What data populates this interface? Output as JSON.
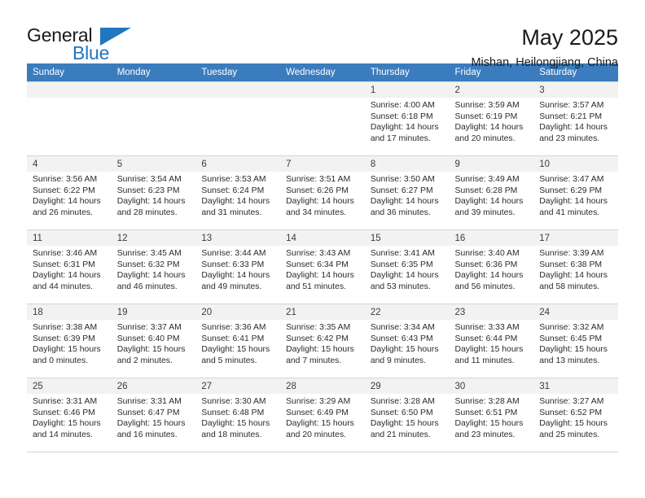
{
  "brand": {
    "name_top": "General",
    "name_bottom": "Blue",
    "accent_color": "#2077c0",
    "flag_icon": "brand-flag-icon"
  },
  "header": {
    "title": "May 2025",
    "subtitle": "Mishan, Heilongjiang, China"
  },
  "calendar": {
    "header_bg": "#3a7cbe",
    "daynum_bg": "#f2f2f2",
    "grid_line_color": "#d5d5d5",
    "weekday_headers": [
      "Sunday",
      "Monday",
      "Tuesday",
      "Wednesday",
      "Thursday",
      "Friday",
      "Saturday"
    ],
    "weeks": [
      [
        {
          "day": ""
        },
        {
          "day": ""
        },
        {
          "day": ""
        },
        {
          "day": ""
        },
        {
          "day": "1",
          "sunrise": "Sunrise: 4:00 AM",
          "sunset": "Sunset: 6:18 PM",
          "daylight_1": "Daylight: 14 hours",
          "daylight_2": "and 17 minutes."
        },
        {
          "day": "2",
          "sunrise": "Sunrise: 3:59 AM",
          "sunset": "Sunset: 6:19 PM",
          "daylight_1": "Daylight: 14 hours",
          "daylight_2": "and 20 minutes."
        },
        {
          "day": "3",
          "sunrise": "Sunrise: 3:57 AM",
          "sunset": "Sunset: 6:21 PM",
          "daylight_1": "Daylight: 14 hours",
          "daylight_2": "and 23 minutes."
        }
      ],
      [
        {
          "day": "4",
          "sunrise": "Sunrise: 3:56 AM",
          "sunset": "Sunset: 6:22 PM",
          "daylight_1": "Daylight: 14 hours",
          "daylight_2": "and 26 minutes."
        },
        {
          "day": "5",
          "sunrise": "Sunrise: 3:54 AM",
          "sunset": "Sunset: 6:23 PM",
          "daylight_1": "Daylight: 14 hours",
          "daylight_2": "and 28 minutes."
        },
        {
          "day": "6",
          "sunrise": "Sunrise: 3:53 AM",
          "sunset": "Sunset: 6:24 PM",
          "daylight_1": "Daylight: 14 hours",
          "daylight_2": "and 31 minutes."
        },
        {
          "day": "7",
          "sunrise": "Sunrise: 3:51 AM",
          "sunset": "Sunset: 6:26 PM",
          "daylight_1": "Daylight: 14 hours",
          "daylight_2": "and 34 minutes."
        },
        {
          "day": "8",
          "sunrise": "Sunrise: 3:50 AM",
          "sunset": "Sunset: 6:27 PM",
          "daylight_1": "Daylight: 14 hours",
          "daylight_2": "and 36 minutes."
        },
        {
          "day": "9",
          "sunrise": "Sunrise: 3:49 AM",
          "sunset": "Sunset: 6:28 PM",
          "daylight_1": "Daylight: 14 hours",
          "daylight_2": "and 39 minutes."
        },
        {
          "day": "10",
          "sunrise": "Sunrise: 3:47 AM",
          "sunset": "Sunset: 6:29 PM",
          "daylight_1": "Daylight: 14 hours",
          "daylight_2": "and 41 minutes."
        }
      ],
      [
        {
          "day": "11",
          "sunrise": "Sunrise: 3:46 AM",
          "sunset": "Sunset: 6:31 PM",
          "daylight_1": "Daylight: 14 hours",
          "daylight_2": "and 44 minutes."
        },
        {
          "day": "12",
          "sunrise": "Sunrise: 3:45 AM",
          "sunset": "Sunset: 6:32 PM",
          "daylight_1": "Daylight: 14 hours",
          "daylight_2": "and 46 minutes."
        },
        {
          "day": "13",
          "sunrise": "Sunrise: 3:44 AM",
          "sunset": "Sunset: 6:33 PM",
          "daylight_1": "Daylight: 14 hours",
          "daylight_2": "and 49 minutes."
        },
        {
          "day": "14",
          "sunrise": "Sunrise: 3:43 AM",
          "sunset": "Sunset: 6:34 PM",
          "daylight_1": "Daylight: 14 hours",
          "daylight_2": "and 51 minutes."
        },
        {
          "day": "15",
          "sunrise": "Sunrise: 3:41 AM",
          "sunset": "Sunset: 6:35 PM",
          "daylight_1": "Daylight: 14 hours",
          "daylight_2": "and 53 minutes."
        },
        {
          "day": "16",
          "sunrise": "Sunrise: 3:40 AM",
          "sunset": "Sunset: 6:36 PM",
          "daylight_1": "Daylight: 14 hours",
          "daylight_2": "and 56 minutes."
        },
        {
          "day": "17",
          "sunrise": "Sunrise: 3:39 AM",
          "sunset": "Sunset: 6:38 PM",
          "daylight_1": "Daylight: 14 hours",
          "daylight_2": "and 58 minutes."
        }
      ],
      [
        {
          "day": "18",
          "sunrise": "Sunrise: 3:38 AM",
          "sunset": "Sunset: 6:39 PM",
          "daylight_1": "Daylight: 15 hours",
          "daylight_2": "and 0 minutes."
        },
        {
          "day": "19",
          "sunrise": "Sunrise: 3:37 AM",
          "sunset": "Sunset: 6:40 PM",
          "daylight_1": "Daylight: 15 hours",
          "daylight_2": "and 2 minutes."
        },
        {
          "day": "20",
          "sunrise": "Sunrise: 3:36 AM",
          "sunset": "Sunset: 6:41 PM",
          "daylight_1": "Daylight: 15 hours",
          "daylight_2": "and 5 minutes."
        },
        {
          "day": "21",
          "sunrise": "Sunrise: 3:35 AM",
          "sunset": "Sunset: 6:42 PM",
          "daylight_1": "Daylight: 15 hours",
          "daylight_2": "and 7 minutes."
        },
        {
          "day": "22",
          "sunrise": "Sunrise: 3:34 AM",
          "sunset": "Sunset: 6:43 PM",
          "daylight_1": "Daylight: 15 hours",
          "daylight_2": "and 9 minutes."
        },
        {
          "day": "23",
          "sunrise": "Sunrise: 3:33 AM",
          "sunset": "Sunset: 6:44 PM",
          "daylight_1": "Daylight: 15 hours",
          "daylight_2": "and 11 minutes."
        },
        {
          "day": "24",
          "sunrise": "Sunrise: 3:32 AM",
          "sunset": "Sunset: 6:45 PM",
          "daylight_1": "Daylight: 15 hours",
          "daylight_2": "and 13 minutes."
        }
      ],
      [
        {
          "day": "25",
          "sunrise": "Sunrise: 3:31 AM",
          "sunset": "Sunset: 6:46 PM",
          "daylight_1": "Daylight: 15 hours",
          "daylight_2": "and 14 minutes."
        },
        {
          "day": "26",
          "sunrise": "Sunrise: 3:31 AM",
          "sunset": "Sunset: 6:47 PM",
          "daylight_1": "Daylight: 15 hours",
          "daylight_2": "and 16 minutes."
        },
        {
          "day": "27",
          "sunrise": "Sunrise: 3:30 AM",
          "sunset": "Sunset: 6:48 PM",
          "daylight_1": "Daylight: 15 hours",
          "daylight_2": "and 18 minutes."
        },
        {
          "day": "28",
          "sunrise": "Sunrise: 3:29 AM",
          "sunset": "Sunset: 6:49 PM",
          "daylight_1": "Daylight: 15 hours",
          "daylight_2": "and 20 minutes."
        },
        {
          "day": "29",
          "sunrise": "Sunrise: 3:28 AM",
          "sunset": "Sunset: 6:50 PM",
          "daylight_1": "Daylight: 15 hours",
          "daylight_2": "and 21 minutes."
        },
        {
          "day": "30",
          "sunrise": "Sunrise: 3:28 AM",
          "sunset": "Sunset: 6:51 PM",
          "daylight_1": "Daylight: 15 hours",
          "daylight_2": "and 23 minutes."
        },
        {
          "day": "31",
          "sunrise": "Sunrise: 3:27 AM",
          "sunset": "Sunset: 6:52 PM",
          "daylight_1": "Daylight: 15 hours",
          "daylight_2": "and 25 minutes."
        }
      ]
    ]
  }
}
